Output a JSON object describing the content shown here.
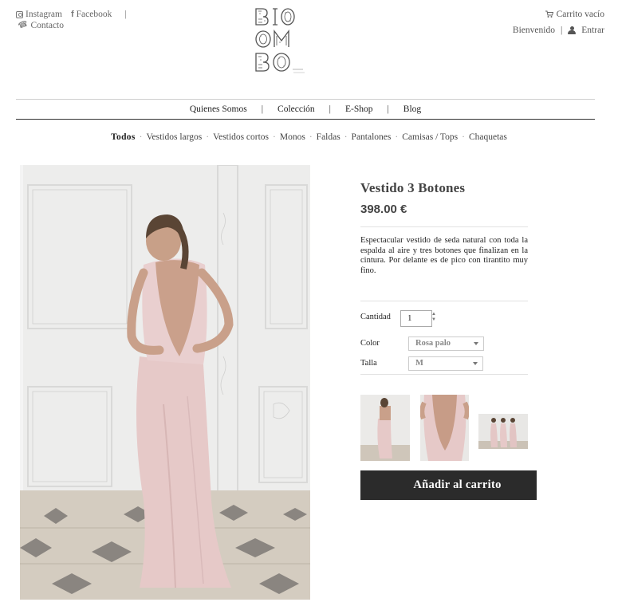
{
  "header": {
    "social": {
      "instagram_label": "Instagram",
      "facebook_label": "Facebook",
      "separator": "|",
      "contact_label": "Contacto"
    },
    "logo_alt": "BIOMBO",
    "cart_label": "Carrito vacío",
    "welcome_label": "Bienvenido",
    "separator": "|",
    "login_label": "Entrar"
  },
  "main_nav": {
    "items": [
      "Quienes Somos",
      "Colección",
      "E-Shop",
      "Blog"
    ],
    "separator": "|"
  },
  "category_nav": {
    "items": [
      "Todos",
      "Vestidos largos",
      "Vestidos cortos",
      "Monos",
      "Faldas",
      "Pantalones",
      "Camisas / Tops",
      "Chaquetas"
    ],
    "active": "Todos",
    "separator": "·"
  },
  "product": {
    "title": "Vestido 3 Botones",
    "price": "398.00 €",
    "description": "Espectacular vestido de seda natural con toda la espalda al aire y tres botones que finalizan en la cintura. Por delante es de pico con tirantito muy fino.",
    "quantity_label": "Cantidad",
    "quantity_value": "1",
    "color_label": "Color",
    "color_value": "Rosa palo",
    "size_label": "Talla",
    "size_value": "M",
    "add_to_cart_label": "Añadir al carrito"
  },
  "colors": {
    "button_bg": "#2b2b2b",
    "dress": "#e9cfcf",
    "wall": "#efefee"
  }
}
